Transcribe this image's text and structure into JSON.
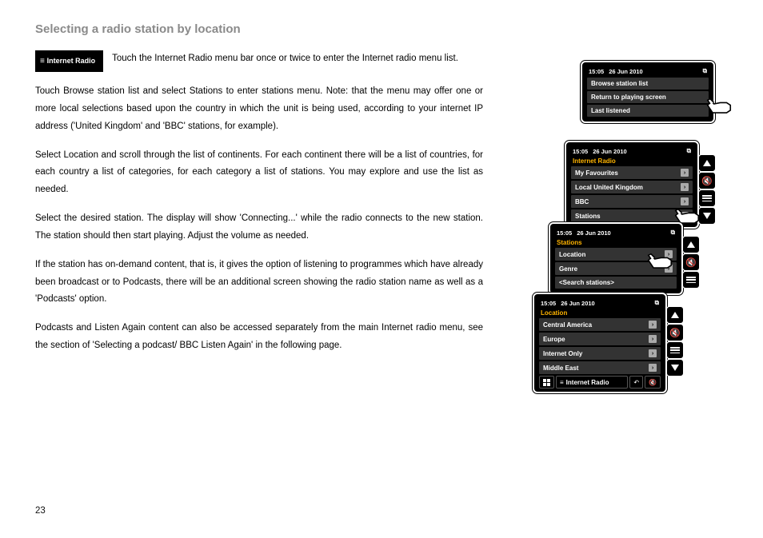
{
  "page": {
    "heading": "Selecting a radio station by location",
    "menu_pill": "Internet Radio",
    "page_number": "23",
    "para1": "Touch the Internet Radio menu bar once or twice to enter the Internet radio menu list.",
    "para2": "Touch Browse station list and select Stations to enter stations menu.\nNote: that the menu may offer one or more local selections based upon the country in which the unit is being used, according to your internet IP address ('United Kingdom' and 'BBC' stations, for example).",
    "para3": "Select Location and scroll through the list of continents. For each continent there will be a list of countries, for each country a list of categories, for each category a list of stations. You may explore and use the list as needed.",
    "para4": "Select the desired station. The display will show 'Connecting...' while the radio connects to the new station. The station should then start playing. Adjust the volume as needed.",
    "para5": "If the station has on-demand content, that is, it gives the option of listening to programmes which have already been broadcast or to Podcasts, there will be an additional screen showing the radio station name as well as a 'Podcasts' option.",
    "para6": "Podcasts and Listen Again content can also be accessed separately from the main Internet radio menu, see the section of 'Selecting a podcast/ BBC Listen Again' in the following page."
  },
  "status": {
    "time": "15:05",
    "date": "26 Jun 2010"
  },
  "screens": {
    "s1": {
      "rows": [
        "Browse station list",
        "Return to playing screen",
        "Last listened"
      ]
    },
    "s2": {
      "title": "Internet Radio",
      "rows": [
        "My Favourites",
        "Local United Kingdom",
        "BBC",
        "Stations"
      ]
    },
    "s3": {
      "title": "Stations",
      "rows": [
        "Location",
        "Genre",
        "<Search stations>"
      ]
    },
    "s4": {
      "title": "Location",
      "rows": [
        "Central America",
        "Europe",
        "Internet Only",
        "Middle East"
      ],
      "bottom_label": "Internet Radio"
    }
  }
}
